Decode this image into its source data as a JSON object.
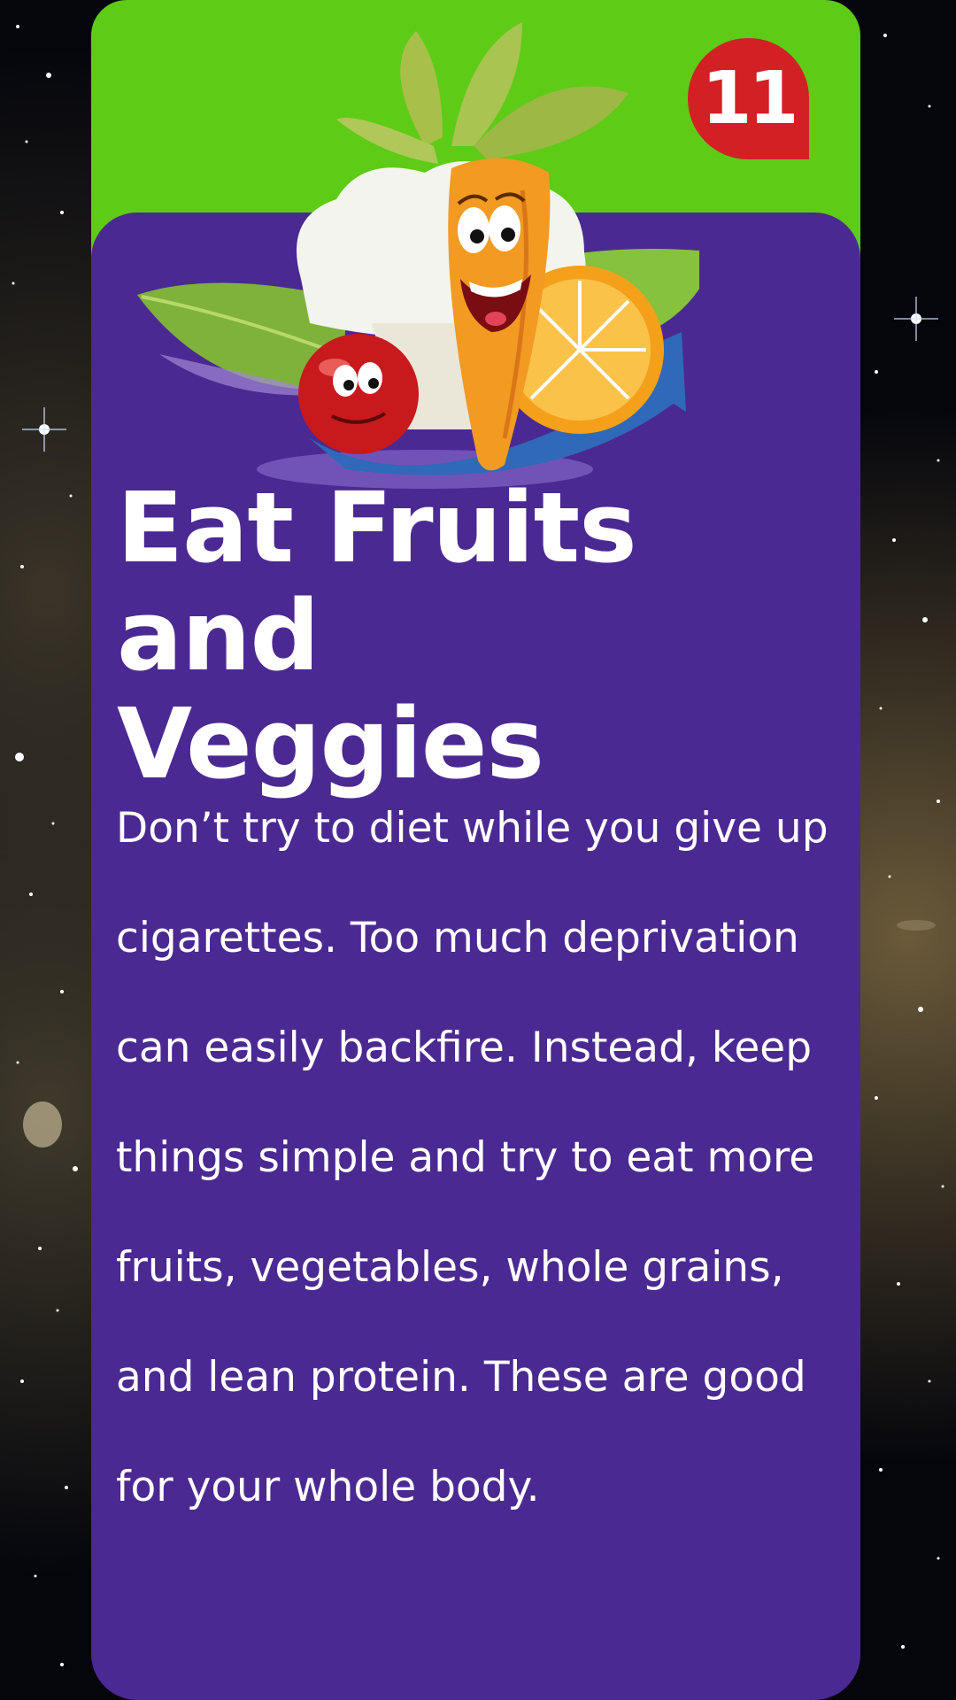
{
  "badge": {
    "number": "11"
  },
  "title": {
    "line1": "Eat Fruits and",
    "line2": "Veggies"
  },
  "body": {
    "lines": [
      "Don’t try to diet while you give up",
      "cigarettes. Too much deprivation",
      "can easily backfire. Instead, keep",
      "things simple and try to eat more",
      "fruits, vegetables, whole grains,",
      "and lean protein. These are good",
      "for your whole body."
    ]
  },
  "colors": {
    "header_green": "#5ecb16",
    "card_purple": "#4b2992",
    "badge_red": "#d32025",
    "text": "#ffffff"
  },
  "icons": [
    "starfield-background",
    "vegetable-characters-illustration"
  ]
}
